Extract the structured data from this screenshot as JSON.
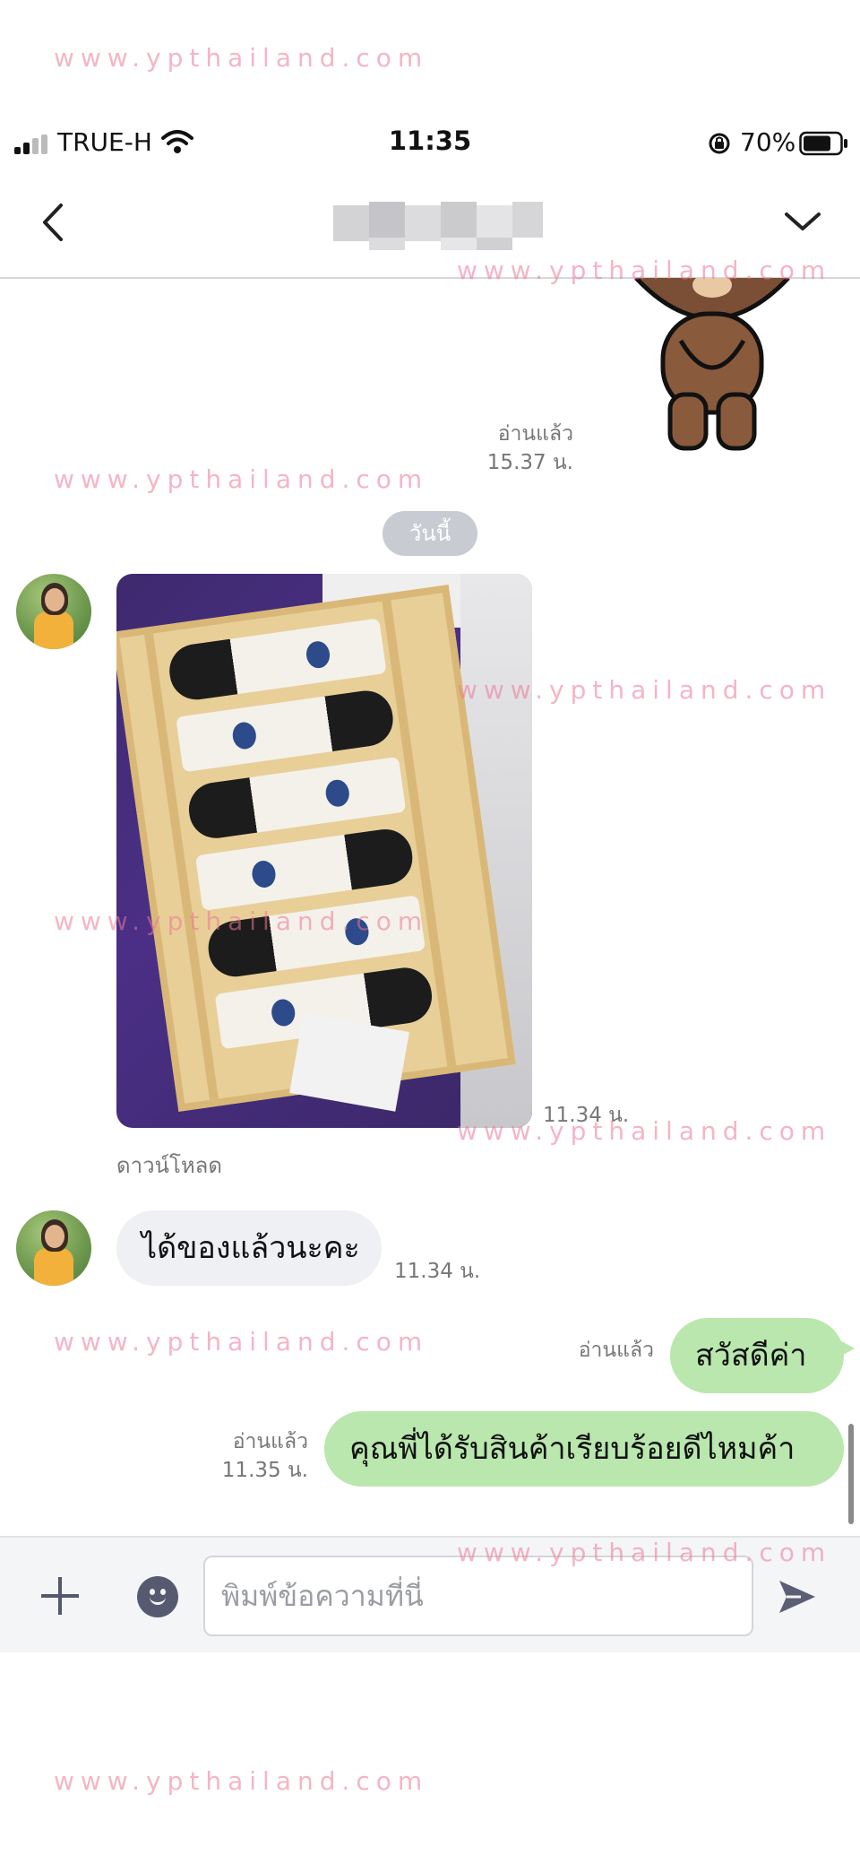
{
  "watermark": "www.ypthailand.com",
  "status_bar": {
    "carrier": "TRUE-H",
    "time": "11:35",
    "battery": "70%"
  },
  "header": {
    "back_icon": "chevron-left-icon",
    "menu_icon": "chevron-down-icon"
  },
  "messages": {
    "sticker_read": "อ่านแล้ว",
    "sticker_time": "15.37 น.",
    "day_separator": "วันนี้",
    "photo_time": "11.34 น.",
    "download_label": "ดาวน์โหลด",
    "incoming_text": "ได้ของแล้วนะคะ",
    "incoming_time": "11.34 น.",
    "outgoing_1_read": "อ่านแล้ว",
    "outgoing_1_text": "สวัสดีค่า",
    "outgoing_2_read": "อ่านแล้ว",
    "outgoing_2_time": "11.35 น.",
    "outgoing_2_text": "คุณพี่ได้รับสินค้าเรียบร้อยดีไหมค้า"
  },
  "input_bar": {
    "placeholder": "พิมพ์ข้อความที่นี่",
    "value": ""
  },
  "colors": {
    "outgoing_bubble": "#b9e7ad",
    "incoming_bubble": "#eef0f3",
    "watermark": "#eb7896"
  }
}
